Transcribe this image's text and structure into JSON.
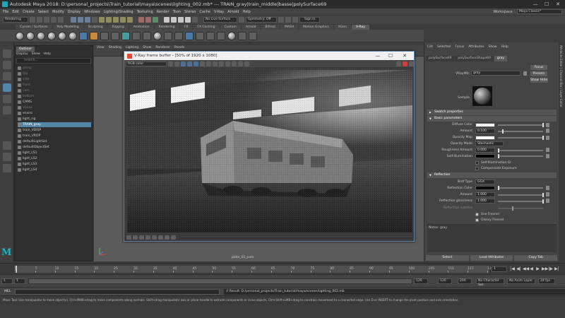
{
  "window": {
    "title": "Autodesk Maya 2018: D:\\personal_projects\\Train_tutorial\\maya\\scenes\\lighting_002.mb*   ---   TRAIN_gray|train_middle|basse|polySurface69",
    "minimize": "—",
    "maximize": "☐",
    "close": "✕"
  },
  "menubar": {
    "items": [
      "File",
      "Edit",
      "Create",
      "Select",
      "Modify",
      "Display",
      "Windows",
      "Lighting/Shading",
      "Texturing",
      "Render",
      "Toon",
      "Stereo",
      "Cache",
      "V-Ray",
      "Arnold",
      "Help"
    ],
    "workspace_label": "Workspace :",
    "workspace_value": "Maya Classic*"
  },
  "statusline": {
    "mode": "Rendering",
    "live_surface": "No Live Surface",
    "symmetry": "Symmetry: Off",
    "sign_in": "Sign In"
  },
  "shelf_tabs": [
    "Curves / Surfaces",
    "Poly Modeling",
    "Sculpting",
    "Rigging",
    "Animation",
    "Rendering",
    "FX",
    "FX Caching",
    "Custom",
    "Arnold",
    "Bifrost",
    "MASH",
    "Motion Graphics",
    "XGen",
    "V-Ray"
  ],
  "shelf_active_index": 14,
  "outliner": {
    "tab": "Outliner",
    "menu": [
      "Display",
      "Show",
      "Help"
    ],
    "search_placeholder": "Search...",
    "items": [
      {
        "label": "persp",
        "dim": true,
        "sel": false
      },
      {
        "label": "top",
        "dim": true,
        "sel": false
      },
      {
        "label": "side",
        "dim": true,
        "sel": false
      },
      {
        "label": "front",
        "dim": true,
        "sel": false
      },
      {
        "label": "cam",
        "dim": true,
        "sel": false
      },
      {
        "label": "bottom",
        "dim": true,
        "sel": false
      },
      {
        "label": "CAMS",
        "dim": false,
        "sel": false
      },
      {
        "label": "Vbase",
        "dim": true,
        "sel": false
      },
      {
        "label": "enviro",
        "dim": false,
        "sel": false
      },
      {
        "label": "light_rig",
        "dim": false,
        "sel": false
      },
      {
        "label": "TRAIN_gray",
        "dim": false,
        "sel": true
      },
      {
        "label": "train_VDISP",
        "dim": false,
        "sel": false
      },
      {
        "label": "train_VROP",
        "dim": false,
        "sel": false
      },
      {
        "label": "defaultLightSet",
        "dim": false,
        "sel": false
      },
      {
        "label": "defaultObjectSet",
        "dim": false,
        "sel": false
      },
      {
        "label": "light_LS1",
        "dim": false,
        "sel": false
      },
      {
        "label": "light_LS2",
        "dim": false,
        "sel": false
      },
      {
        "label": "light_LS3",
        "dim": false,
        "sel": false
      },
      {
        "label": "light_LS4",
        "dim": false,
        "sel": false
      }
    ]
  },
  "viewport": {
    "menu": [
      "View",
      "Shading",
      "Lighting",
      "Show",
      "Renderer",
      "Panels"
    ],
    "camera_label": "plate_01_cam"
  },
  "vfb": {
    "title": "V-Ray frame buffer - [50% of 1920 x 1080]",
    "channel": "RGB color"
  },
  "attribute_editor": {
    "menu": [
      "List",
      "Selected",
      "Focus",
      "Attributes",
      "Show",
      "Help"
    ],
    "tabs": [
      "polySurface69",
      "polySurfaceShape69",
      "gray"
    ],
    "active_tab": 2,
    "material_type_label": "VRayMtl:",
    "material_name": "gray",
    "buttons": {
      "focus": "Focus",
      "presets": "Presets",
      "show": "Show",
      "hide": "Hide"
    },
    "sample_label": "Sample",
    "sections": {
      "swatch": "Swatch properties",
      "basic": "Basic parameters",
      "reflection": "Reflection"
    },
    "basic": {
      "diffuse_color": "Diffuse Color",
      "amount": "Amount",
      "amount_value": "0.100",
      "opacity_map": "Opacity Map",
      "opacity_mode": "Opacity Mode",
      "opacity_mode_value": "Stochastic",
      "roughness_amount": "Roughness Amount",
      "roughness_value": "0.000",
      "self_illumination": "Self-Illumination",
      "self_illum_gi": "Self-Illumination GI",
      "comp_exposure": "Compensate Exposure"
    },
    "reflection": {
      "brdf_type": "Brdf Type",
      "brdf_value": "GGX",
      "reflection_color": "Reflection Color",
      "amount": "Amount",
      "amount_value": "1.000",
      "glossiness": "Reflection glossiness",
      "glossiness_value": "1.000",
      "subdivs": "Reflection subdivs",
      "use_fresnel": "Use Fresnel",
      "glossy_fresnel": "Glossy Fresnel"
    },
    "notes_label": "Notes:  gray",
    "bottom_buttons": [
      "Select",
      "Load Attributes",
      "Copy Tab"
    ],
    "side_strip": "Attribute Editor  |  Channel Box / Layer Editor"
  },
  "timeslider": {
    "ticks": [
      "1",
      "5",
      "10",
      "15",
      "20",
      "25",
      "30",
      "35",
      "40",
      "45",
      "50",
      "55",
      "60",
      "65",
      "70",
      "75",
      "80",
      "85",
      "90",
      "95",
      "100",
      "105",
      "110",
      "115",
      "120"
    ],
    "current_frame": "1",
    "controls": [
      "|◀",
      "◀|",
      "◀◀",
      "◀",
      "▶",
      "▶▶",
      "|▶",
      "▶|"
    ]
  },
  "range": {
    "start": "1",
    "start_inner": "1",
    "end_inner": "120",
    "end": "120",
    "end2": "200",
    "character_set": "No Character Set",
    "anim_layer": "No Anim Layer",
    "fps": "24 fps"
  },
  "command": {
    "mel": "MEL",
    "result": "// Result: D:/personal_projects/Train_tutorial/maya/scenes/lighting_002.mb"
  },
  "help": {
    "text": "Move Tool: Use manipulator to move object(s). Ctrl+MMB+drag to move components along normals. Shift+drag manipulator axis or plane handle to extrude components or clone objects. Ctrl+Shift+LMB+drag to constrain movement to a connected edge. Use D or INSERT to change the pivot position and axis orientation."
  },
  "colors": {
    "accent": "#5285a6",
    "vfb_border": "#5c84a8",
    "maya_logo": "#1fb5c2"
  }
}
